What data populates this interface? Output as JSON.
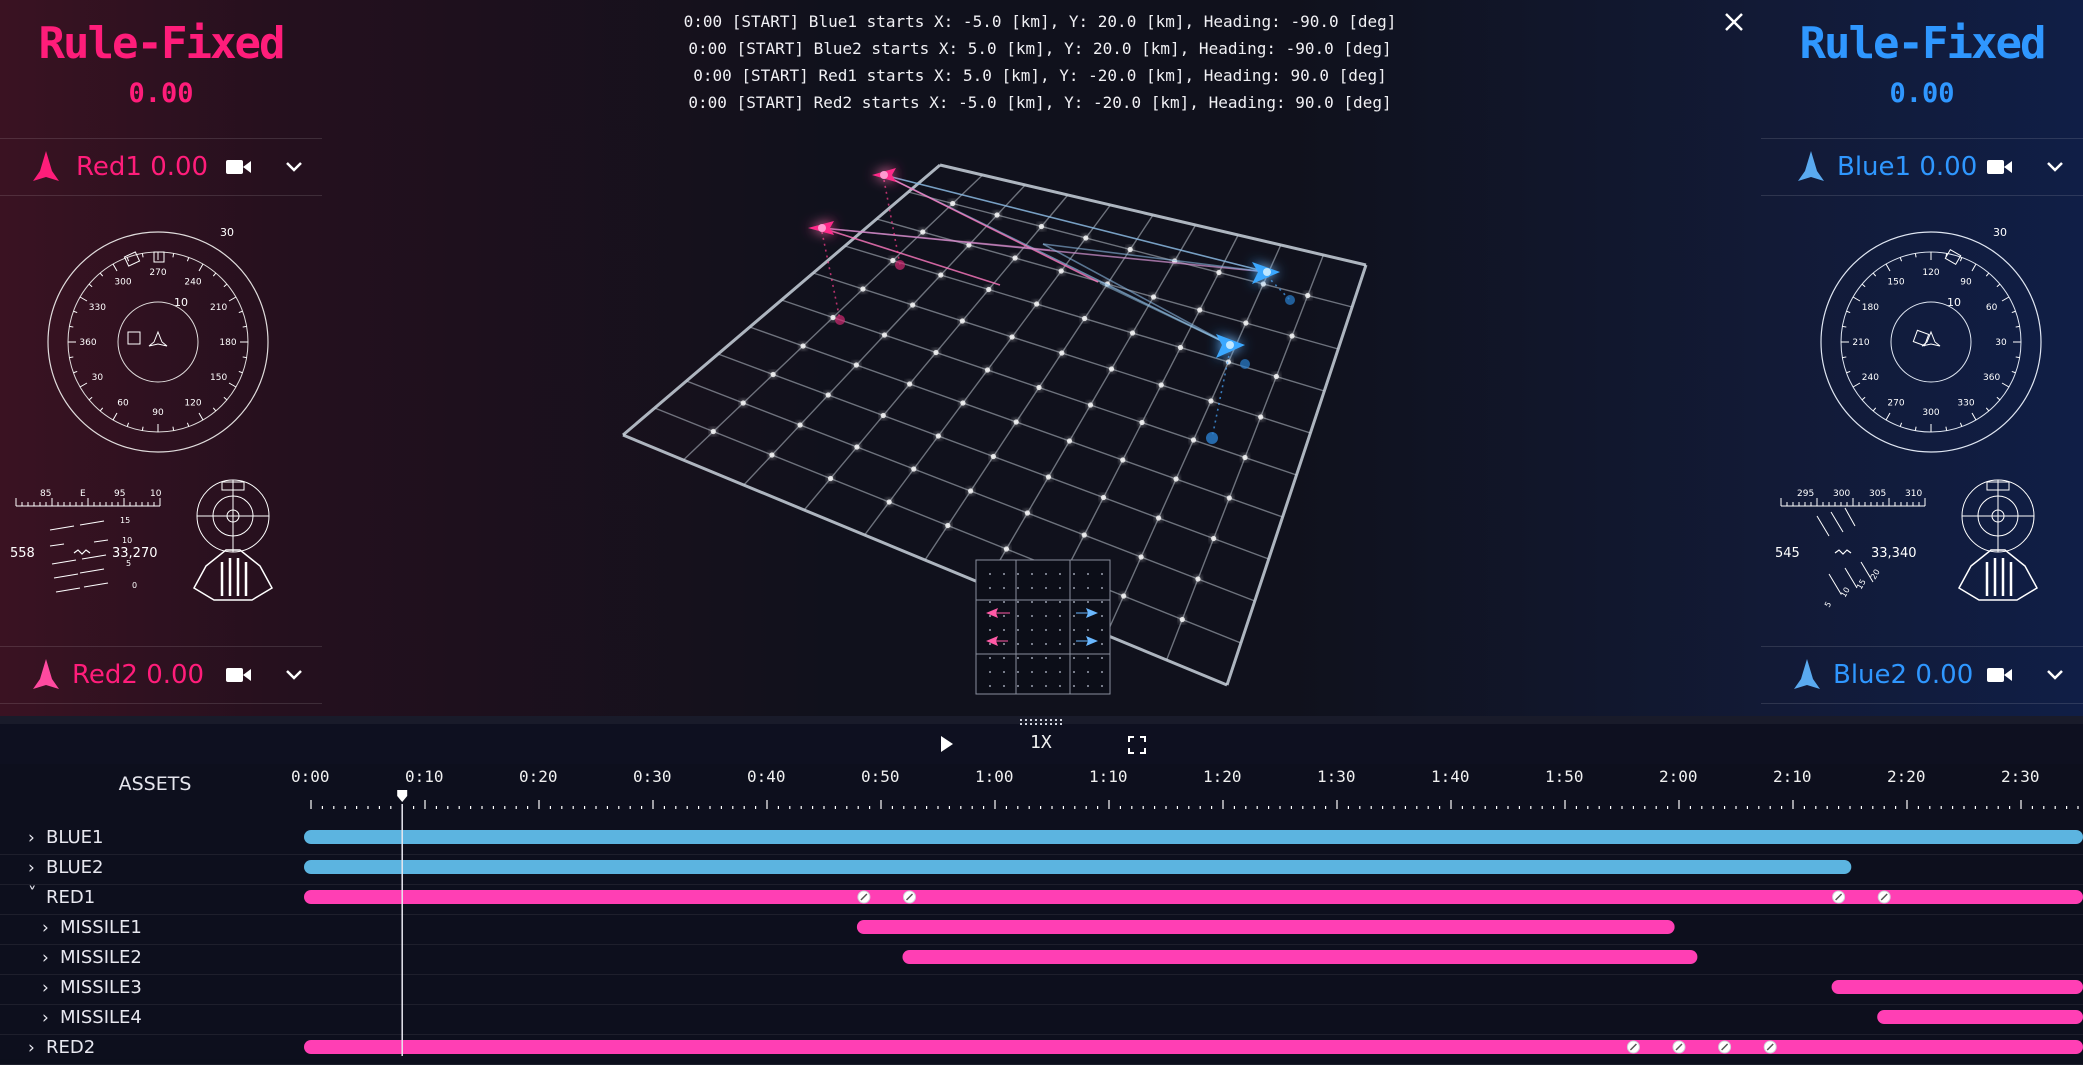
{
  "red_panel": {
    "team_name": "Rule-Fixed",
    "team_score": "0.00",
    "unit1": {
      "label": "Red1 0.00"
    },
    "unit2": {
      "label": "Red2 0.00"
    },
    "radar": {
      "outer_range": "30",
      "inner_range": "10",
      "bearings": [
        "270",
        "240",
        "210",
        "180",
        "150",
        "120",
        "90",
        "60",
        "30",
        "360",
        "330",
        "300"
      ]
    },
    "speed_value": "558",
    "altitude_value": "33,270",
    "heading_tape": [
      "85",
      "E",
      "95",
      "10"
    ],
    "pitch_ladder": [
      "15",
      "10",
      "5",
      "0"
    ]
  },
  "blue_panel": {
    "team_name": "Rule-Fixed",
    "team_score": "0.00",
    "unit1": {
      "label": "Blue1 0.00"
    },
    "unit2": {
      "label": "Blue2 0.00"
    },
    "radar": {
      "outer_range": "30",
      "inner_range": "10",
      "bearings": [
        "120",
        "90",
        "60",
        "30",
        "360",
        "330",
        "300",
        "270",
        "240",
        "210",
        "180",
        "150"
      ]
    },
    "speed_value": "545",
    "altitude_value": "33,340",
    "heading_tape": [
      "295",
      "300",
      "305",
      "310"
    ],
    "pitch_ladder": [
      "20",
      "15",
      "10",
      "5"
    ]
  },
  "log": [
    "0:00 [START] Blue1 starts X: -5.0 [km], Y: 20.0 [km], Heading: -90.0 [deg]",
    "0:00 [START] Blue2 starts X: 5.0 [km], Y: 20.0 [km], Heading: -90.0 [deg]",
    "0:00 [START] Red1 starts X: 5.0 [km], Y: -20.0 [km], Heading: 90.0 [deg]",
    "0:00 [START] Red2 starts X: -5.0 [km], Y: -20.0 [km], Heading: 90.0 [deg]"
  ],
  "controls": {
    "speed": "1X"
  },
  "timeline": {
    "header": "ASSETS",
    "ticks": [
      "0:00",
      "0:10",
      "0:20",
      "0:30",
      "0:40",
      "0:50",
      "1:00",
      "1:10",
      "1:20",
      "1:30",
      "1:40",
      "1:50",
      "2:00",
      "2:10",
      "2:20",
      "2:30"
    ],
    "playhead_seconds": 8,
    "assets": [
      {
        "name": "BLUE1",
        "expanded": false,
        "indent": 0,
        "team": "blue",
        "start": 0,
        "end": 155.5,
        "markers": []
      },
      {
        "name": "BLUE2",
        "expanded": false,
        "indent": 0,
        "team": "blue",
        "start": 0,
        "end": 134.5,
        "markers": []
      },
      {
        "name": "RED1",
        "expanded": true,
        "indent": 0,
        "team": "red",
        "start": 0,
        "end": 157,
        "markers": [
          48.5,
          52.5,
          134,
          138
        ]
      },
      {
        "name": "MISSILE1",
        "expanded": false,
        "indent": 1,
        "team": "red",
        "start": 48.5,
        "end": 119,
        "markers": []
      },
      {
        "name": "MISSILE2",
        "expanded": false,
        "indent": 1,
        "team": "red",
        "start": 52.5,
        "end": 121,
        "markers": []
      },
      {
        "name": "MISSILE3",
        "expanded": false,
        "indent": 1,
        "team": "red",
        "start": 134,
        "end": 155.5,
        "markers": []
      },
      {
        "name": "MISSILE4",
        "expanded": false,
        "indent": 1,
        "team": "red",
        "start": 138,
        "end": 157,
        "markers": []
      },
      {
        "name": "RED2",
        "expanded": false,
        "indent": 0,
        "team": "red",
        "start": 0,
        "end": 157,
        "markers": [
          116,
          120,
          124,
          128
        ]
      }
    ]
  },
  "colors": {
    "red_team": "#ff1d7a",
    "blue_team": "#2f97ff",
    "red_bar": "#ff3fb4",
    "blue_bar": "#5cb4e0",
    "grid": "#c9d2dc"
  },
  "icons": {
    "close": "close-icon",
    "play": "play-icon",
    "fullscreen": "fullscreen-icon",
    "camera": "camera-icon",
    "chevron": "chevron-down-icon",
    "aircraft": "aircraft-icon"
  }
}
